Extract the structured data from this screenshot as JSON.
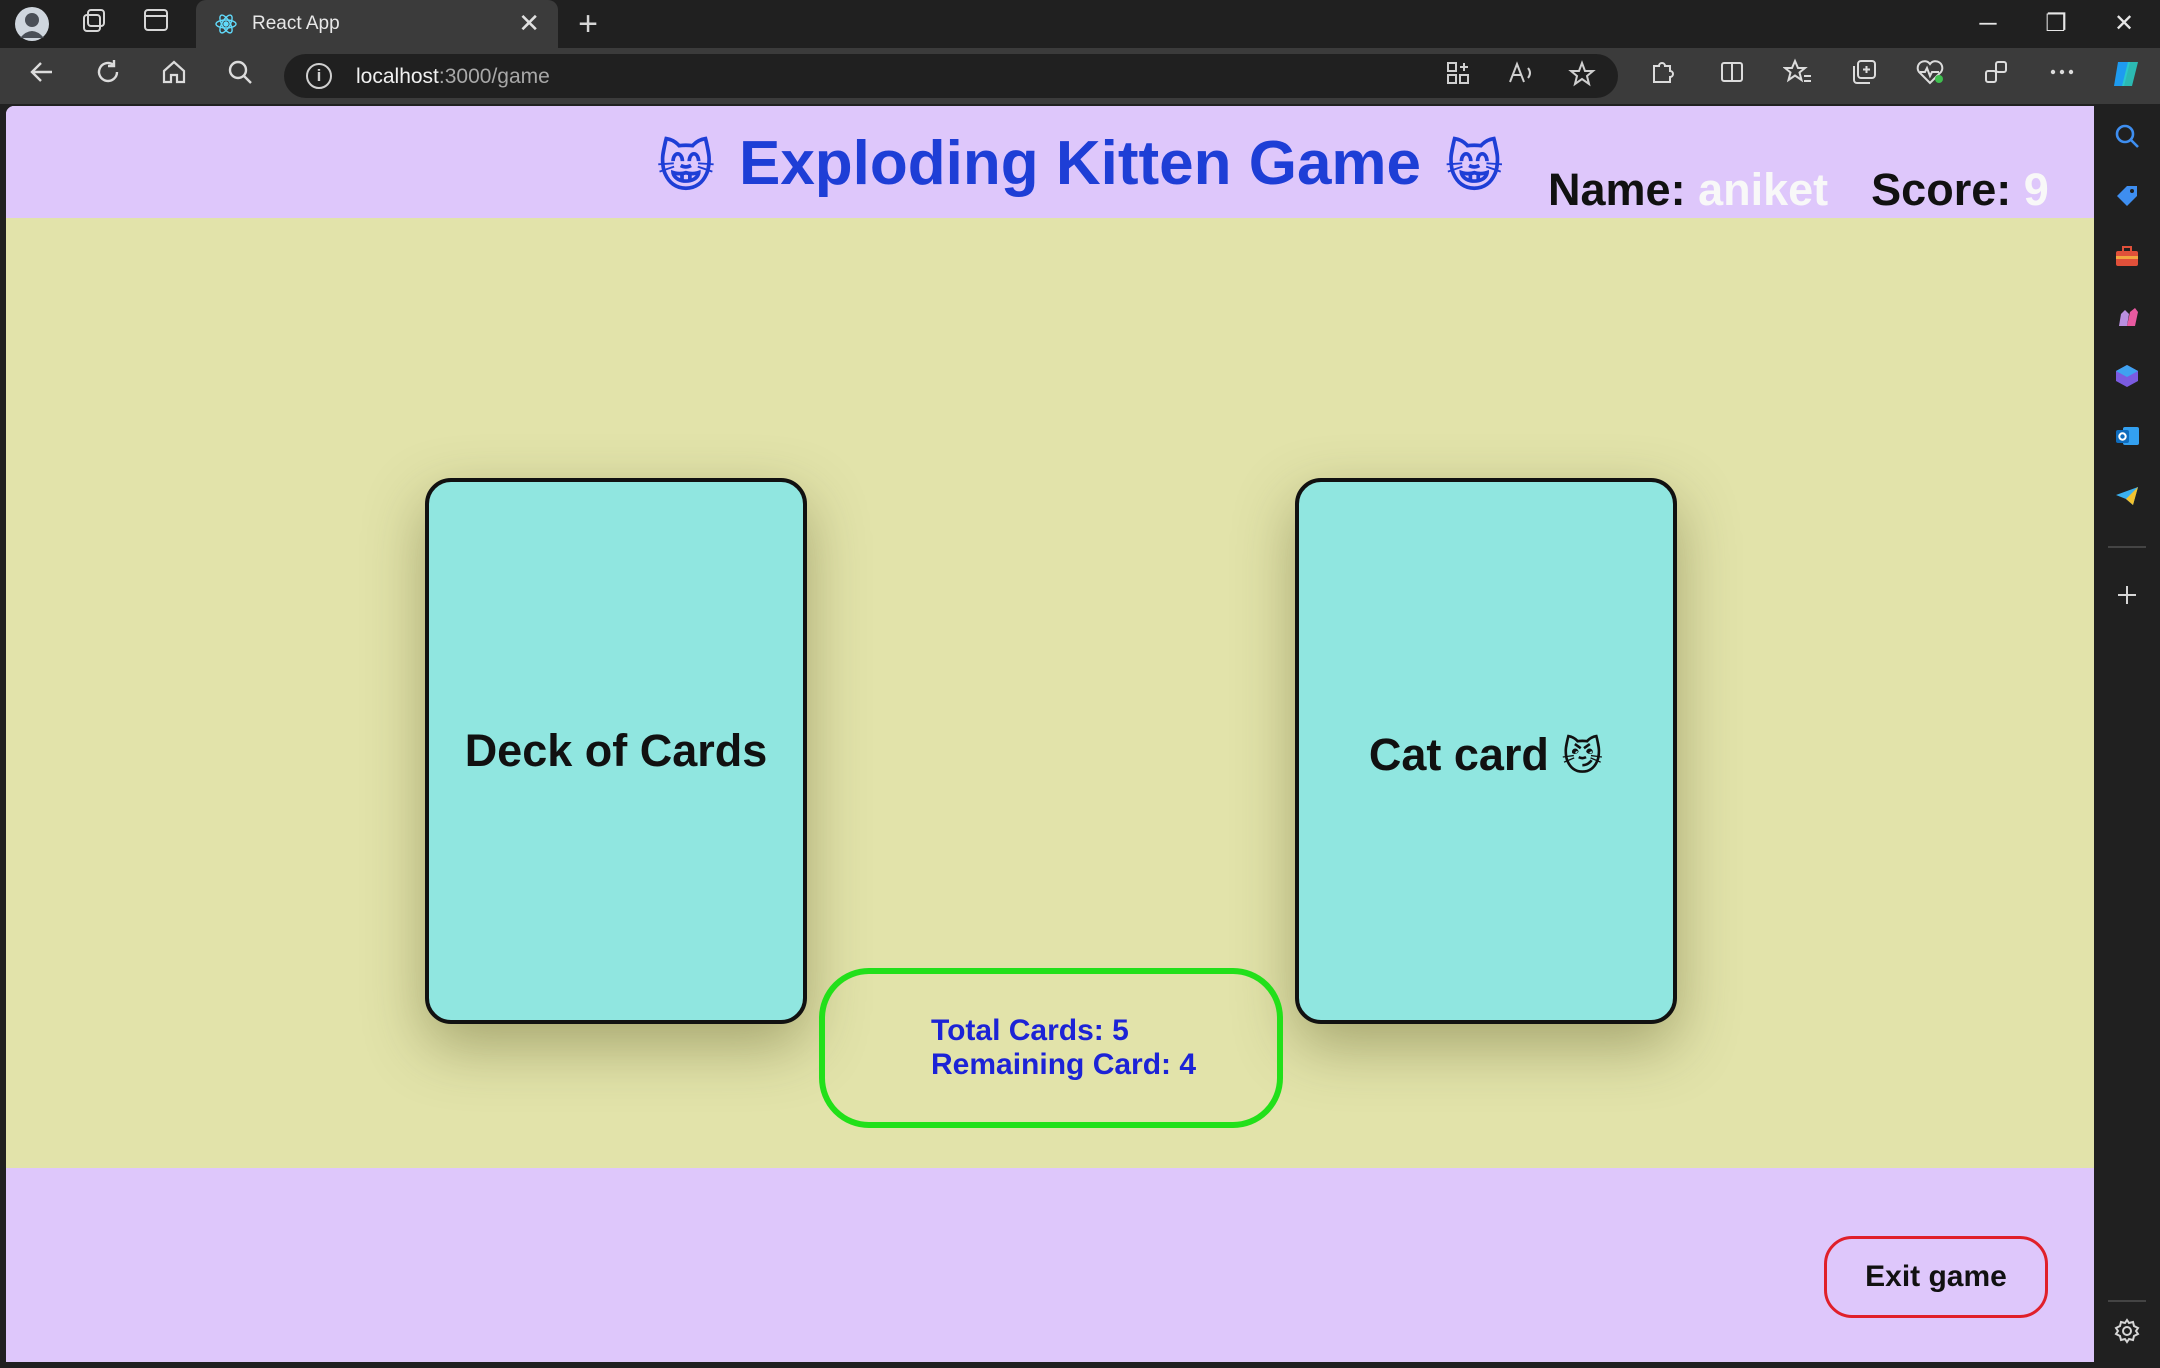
{
  "browser": {
    "tab_title": "React App",
    "tab_close": "✕",
    "new_tab": "+",
    "url_host": "localhost",
    "url_path": ":3000/game",
    "info": "i"
  },
  "window_controls": {
    "minimize": "─",
    "restore": "❐",
    "close": "✕"
  },
  "game": {
    "title": "Exploding Kitten Game",
    "title_emoji_left": "😸",
    "title_emoji_right": "😸",
    "name_label": "Name:",
    "name_value": "aniket",
    "score_label": "Score:",
    "score_value": "9",
    "deck_card_label": "Deck of Cards",
    "drawn_card_label": "Cat card",
    "drawn_card_emoji": "😼",
    "total_cards_text": "Total Cards: 5",
    "remaining_cards_text": "Remaining Card: 4",
    "exit_button": "Exit game"
  },
  "colors": {
    "header_bg": "#dec7fb",
    "play_area_bg": "#e2e3aa",
    "card_bg": "#90e6e0",
    "title_color": "#1e3ed6",
    "stats_border": "#22e01a",
    "stats_text": "#1c23d6",
    "exit_border": "#e0202a"
  },
  "icons": {
    "titlebar": [
      "profile-avatar-icon",
      "workspaces-icon",
      "tab-actions-icon"
    ],
    "nav": [
      "back-icon",
      "refresh-icon",
      "home-icon",
      "search-icon"
    ],
    "toolbar": [
      "app-available-icon",
      "read-aloud-icon",
      "favorite-star-icon",
      "extensions-icon",
      "split-screen-icon",
      "favorites-icon",
      "collections-icon",
      "browser-essentials-icon",
      "share-icon",
      "more-icon",
      "copilot-icon"
    ],
    "sidebar": [
      "sidebar-search-icon",
      "shopping-icon",
      "tools-icon",
      "games-icon",
      "microsoft365-icon",
      "outlook-icon",
      "telegram-icon",
      "add-icon",
      "settings-icon"
    ]
  }
}
